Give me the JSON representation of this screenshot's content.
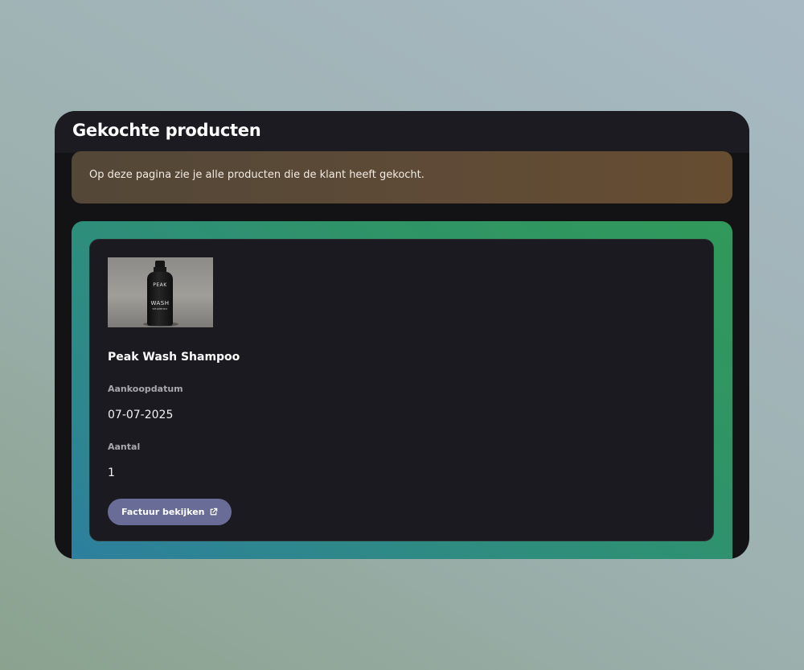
{
  "page": {
    "title": "Gekochte producten"
  },
  "notice": {
    "text": "Op deze pagina zie je alle producten die de klant heeft gekocht."
  },
  "products": [
    {
      "name": "Peak Wash Shampoo",
      "image": {
        "alt": "Peak Wash Shampoo",
        "bottle_label_top": "PEAK",
        "bottle_label_bottom": "WASH",
        "bottle_label_small": "SHAMPOO"
      },
      "purchase_date_label": "Aankoopdatum",
      "purchase_date": "07-07-2025",
      "quantity_label": "Aantal",
      "quantity": "1",
      "invoice_button_label": "Factuur bekijken",
      "invoice_icon": "external-link-icon"
    }
  ],
  "colors": {
    "background_gradient": [
      "#8aa28e",
      "#a8b9c4"
    ],
    "panel": "#131315",
    "notice": "#5d4a37",
    "product_frame_gradient": [
      "#2d7fa0",
      "#31995a"
    ],
    "card": "#1a1a20",
    "button": "#686c96"
  }
}
